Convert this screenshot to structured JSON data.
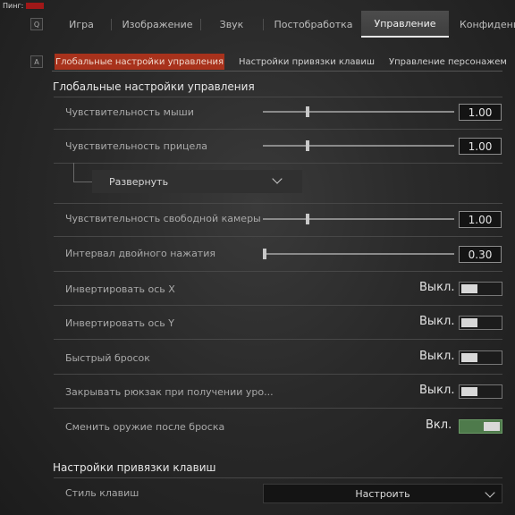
{
  "header": {
    "ping_label": "Пинг:"
  },
  "topnav": {
    "key": "Q",
    "tabs": [
      {
        "label": "Игра"
      },
      {
        "label": "Изображение"
      },
      {
        "label": "Звук"
      },
      {
        "label": "Постобработка"
      },
      {
        "label": "Управление",
        "active": true
      },
      {
        "label": "Конфиденциал"
      }
    ]
  },
  "subnav": {
    "key": "A",
    "tabs": [
      {
        "label": "Глобальные настройки управления",
        "active": true
      },
      {
        "label": "Настройки привязки клавиш"
      },
      {
        "label": "Управление персонажем"
      }
    ]
  },
  "global": {
    "title": "Глобальные настройки управления",
    "mouse_sens": {
      "label": "Чувствительность мыши",
      "value": "1.00",
      "slider_fraction": 0.23
    },
    "aim_sens": {
      "label": "Чувствительность прицела",
      "value": "1.00",
      "slider_fraction": 0.23
    },
    "expand": {
      "label": "Развернуть"
    },
    "free_cam": {
      "label": "Чувствительность свободной камеры",
      "value": "1.00",
      "slider_fraction": 0.23
    },
    "double_tap": {
      "label": "Интервал двойного нажатия",
      "value": "0.30",
      "slider_fraction": 0.0
    },
    "invert_x": {
      "label": "Инвертировать ось X",
      "state": "Выкл.",
      "on": false
    },
    "invert_y": {
      "label": "Инвертировать ось Y",
      "state": "Выкл.",
      "on": false
    },
    "quick_throw": {
      "label": "Быстрый бросок",
      "state": "Выкл.",
      "on": false
    },
    "close_backpack": {
      "label": "Закрывать рюкзак при получении уро...",
      "state": "Выкл.",
      "on": false
    },
    "switch_weapon": {
      "label": "Сменить оружие после броска",
      "state": "Вкл.",
      "on": true
    }
  },
  "keybind": {
    "title": "Настройки привязки клавиш",
    "style": {
      "label": "Стиль клавиш",
      "value": "Настроить"
    }
  },
  "colors": {
    "accent": "#a8321c",
    "toggle_on": "#4e7a4b",
    "ping_bar": "#a01818"
  }
}
